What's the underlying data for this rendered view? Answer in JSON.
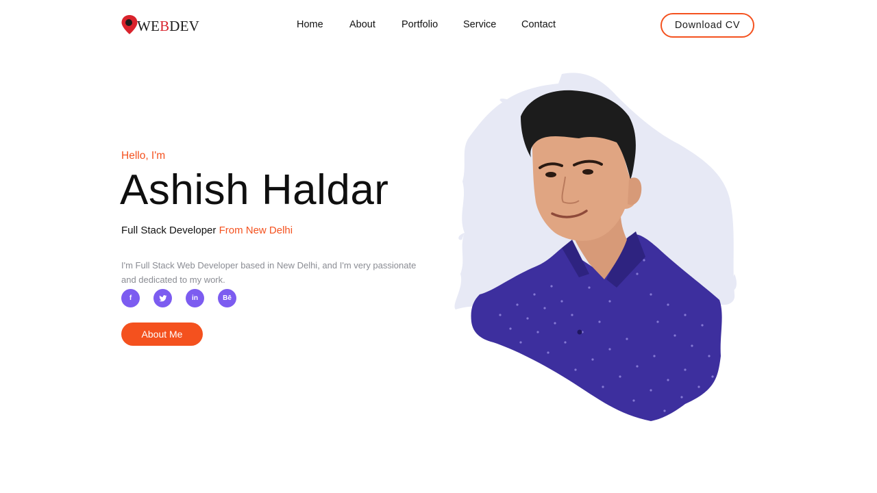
{
  "brand": {
    "logo_prefix": "WE",
    "logo_accent": "B",
    "logo_suffix": "DEV"
  },
  "nav": {
    "items": [
      {
        "label": "Home"
      },
      {
        "label": "About"
      },
      {
        "label": "Portfolio"
      },
      {
        "label": "Service"
      },
      {
        "label": "Contact"
      }
    ],
    "cta_label": "Download CV"
  },
  "hero": {
    "greeting": "Hello, I'm",
    "name": "Ashish Haldar",
    "role": "Full Stack Developer",
    "location": "From New Delhi",
    "bio": "I'm Full Stack Web Developer based in New Delhi, and I'm very passionate and dedicated to my work.",
    "about_button_label": "About Me"
  },
  "socials": [
    {
      "icon": "facebook-icon",
      "glyph": "f"
    },
    {
      "icon": "twitter-icon",
      "glyph": "t"
    },
    {
      "icon": "linkedin-icon",
      "glyph": "in"
    },
    {
      "icon": "behance-icon",
      "glyph": "Bē"
    }
  ],
  "colors": {
    "accent": "#f4511e",
    "social": "#7c5cf0",
    "brush": "#e7e9f5",
    "shirt": "#3d2f9e"
  }
}
